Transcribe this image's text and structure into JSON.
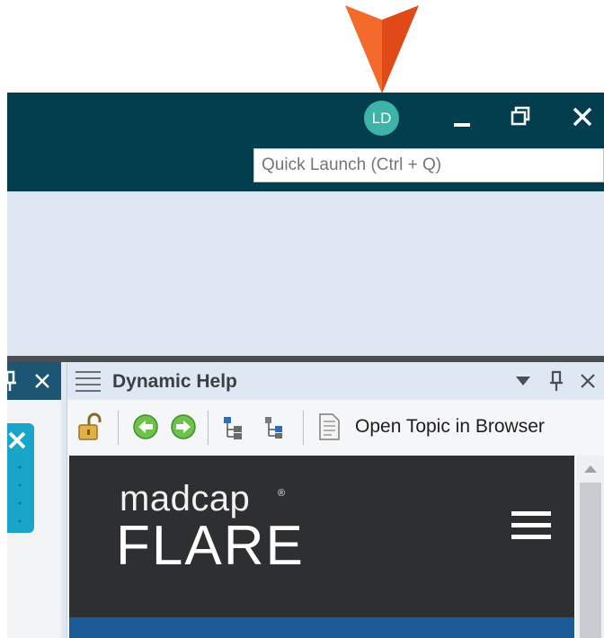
{
  "titlebar": {
    "avatar_initials": "LD",
    "quick_launch_placeholder": "Quick Launch (Ctrl + Q)"
  },
  "dynamic_help": {
    "title": "Dynamic Help",
    "toolbar": {
      "open_topic_label": "Open Topic in Browser"
    }
  },
  "browser_content": {
    "brand_top": "madcap",
    "brand_registered": "®",
    "brand_bottom": "FLARE"
  },
  "colors": {
    "titlebar_bg": "#023e4d",
    "pointer_arrow": "#f25a22",
    "avatar_bg": "#3db4a7",
    "panel_tab_blue": "#19a4c9",
    "site_header_bg": "#2e2f31",
    "site_nav_bar": "#1b5a96"
  },
  "icons": [
    "pointer-arrow-icon",
    "minimize-icon",
    "restore-icon",
    "close-icon",
    "pin-icon",
    "menu-lines-icon",
    "dropdown-icon",
    "lock-icon",
    "back-arrow-icon",
    "forward-arrow-icon",
    "toc-tree-icon",
    "document-icon",
    "hamburger-menu-icon",
    "scroll-up-icon"
  ]
}
